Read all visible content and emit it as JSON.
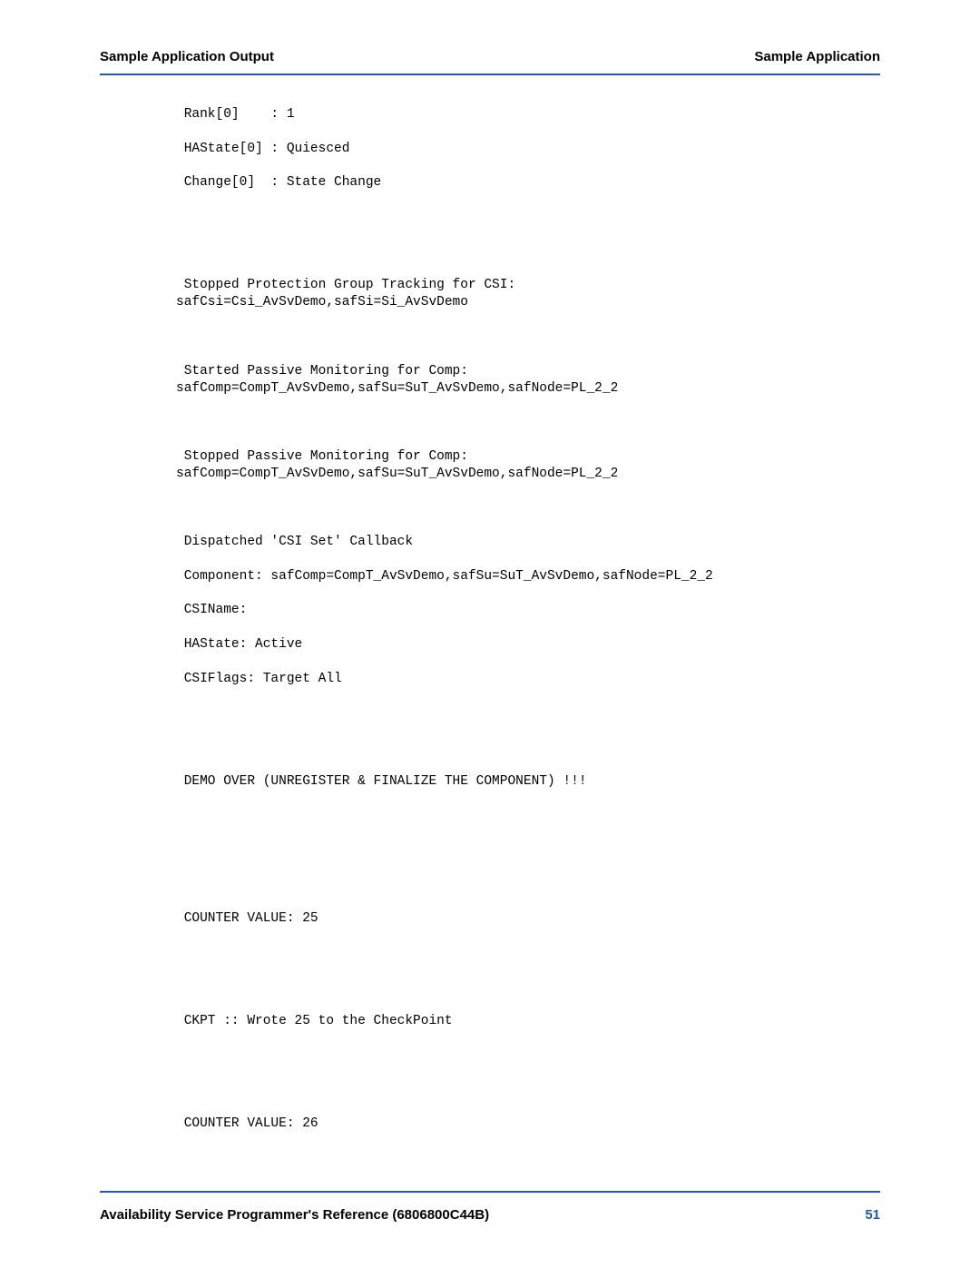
{
  "header": {
    "left": "Sample Application Output",
    "right": "Sample Application"
  },
  "body": {
    "text": " Rank[0]    : 1\n\n HAState[0] : Quiesced\n\n Change[0]  : State Change\n\n\n\n\n\n Stopped Protection Group Tracking for CSI: \nsafCsi=Csi_AvSvDemo,safSi=Si_AvSvDemo\n\n\n\n Started Passive Monitoring for Comp: \nsafComp=CompT_AvSvDemo,safSu=SuT_AvSvDemo,safNode=PL_2_2\n\n\n\n Stopped Passive Monitoring for Comp: \nsafComp=CompT_AvSvDemo,safSu=SuT_AvSvDemo,safNode=PL_2_2\n\n\n\n Dispatched 'CSI Set' Callback\n\n Component: safComp=CompT_AvSvDemo,safSu=SuT_AvSvDemo,safNode=PL_2_2\n\n CSIName: \n\n HAState: Active\n\n CSIFlags: Target All\n\n\n\n\n\n DEMO OVER (UNREGISTER & FINALIZE THE COMPONENT) !!!\n\n\n\n\n\n\n\n COUNTER VALUE: 25\n\n\n\n\n\n CKPT :: Wrote 25 to the CheckPoint\n\n\n\n\n\n COUNTER VALUE: 26"
  },
  "footer": {
    "left": "Availability Service Programmer's Reference (6806800C44B)",
    "right": "51"
  }
}
